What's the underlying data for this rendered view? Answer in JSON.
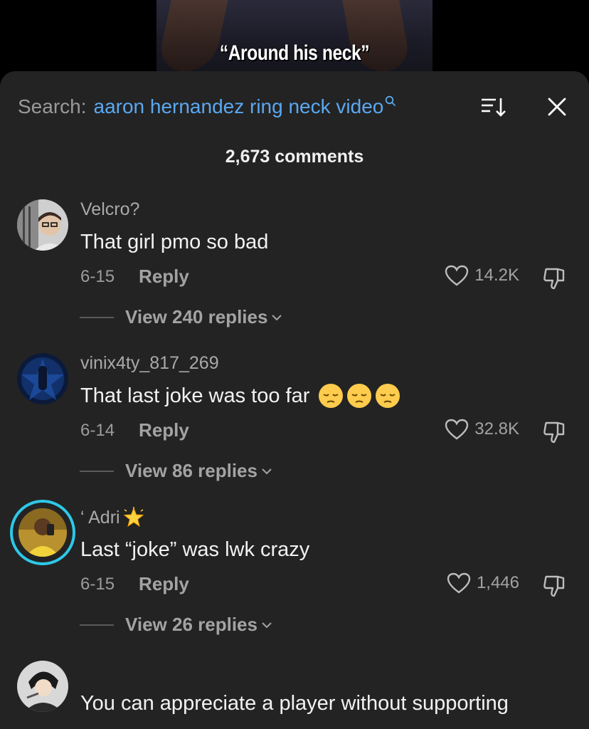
{
  "video": {
    "caption": "“Around his neck”"
  },
  "header": {
    "search_prefix": "Search:",
    "search_query": "aaron hernandez ring neck video",
    "comment_count": "2,673 comments"
  },
  "comments": [
    {
      "username": "Velcro?",
      "text": "That girl pmo so bad",
      "date": "6-15",
      "reply_label": "Reply",
      "likes": "14.2K",
      "view_replies": "View 240 replies"
    },
    {
      "username": "vinix4ty_817_269",
      "text": "That last joke was too far",
      "date": "6-14",
      "reply_label": "Reply",
      "likes": "32.8K",
      "view_replies": "View 86 replies",
      "emojis": [
        "pensive-emoji",
        "pensive-emoji",
        "pensive-emoji"
      ]
    },
    {
      "username": "‘ Adri",
      "text": "Last “joke” was lwk crazy",
      "date": "6-15",
      "reply_label": "Reply",
      "likes": "1,446",
      "view_replies": "View 26 replies",
      "badge": "glowing-star-emoji"
    },
    {
      "username": "",
      "text": "You can appreciate a player without supporting"
    }
  ],
  "colors": {
    "sheet_bg": "#232323",
    "link_blue": "#5aa8f2",
    "muted": "#a3a3a3",
    "story_ring": "#2ec8e8"
  }
}
